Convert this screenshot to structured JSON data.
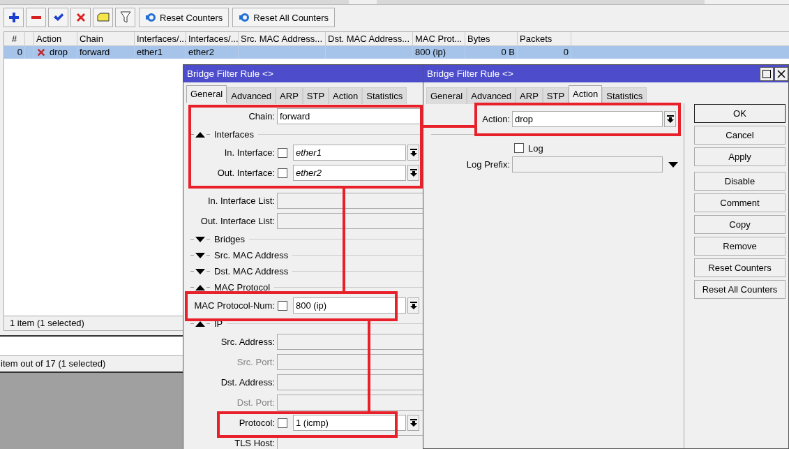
{
  "toolbar": {
    "buttons": [
      "Reset Counters",
      "Reset All Counters"
    ]
  },
  "table": {
    "columns": [
      "#",
      "Action",
      "Chain",
      "Interfaces/...",
      "Interfaces/...",
      "Src. MAC Address...",
      "Dst. MAC Address...",
      "MAC Prot...",
      "Bytes",
      "Packets"
    ],
    "rows": [
      {
        "selected": true,
        "number": "0",
        "action": "drop",
        "chain": "forward",
        "in_interface": "ether1",
        "out_interface": "ether2",
        "mac_protocol": "800 (ip)",
        "bytes": "0 B",
        "packets": "0"
      }
    ]
  },
  "status_bar": "1 item (1 selected)",
  "second_status_bar": "item out of 17 (1 selected)",
  "general_dialog": {
    "title": "Bridge Filter Rule <>",
    "tabs": [
      {
        "label": "General",
        "selected": true
      },
      {
        "label": "Advanced",
        "selected": false
      },
      {
        "label": "ARP",
        "selected": false
      },
      {
        "label": "STP",
        "selected": false
      },
      {
        "label": "Action",
        "selected": false
      },
      {
        "label": "Statistics",
        "selected": false
      }
    ],
    "fields": [
      {
        "kind": "text",
        "label": "Chain:",
        "value": "forward"
      },
      {
        "kind": "section",
        "label": "Interfaces",
        "expanded": true
      },
      {
        "kind": "check",
        "label": "In. Interface:",
        "checked": false,
        "value": "ether1",
        "italic": true
      },
      {
        "kind": "check",
        "label": "Out. Interface:",
        "checked": false,
        "value": "ether2",
        "italic": true
      },
      {
        "kind": "empty",
        "label": "In. Interface List:",
        "disabled": false
      },
      {
        "kind": "empty",
        "label": "Out. Interface List:",
        "disabled": false
      },
      {
        "kind": "section",
        "label": "Bridges",
        "expanded": false
      },
      {
        "kind": "section",
        "label": "Src. MAC Address",
        "expanded": false
      },
      {
        "kind": "section",
        "label": "Dst. MAC Address",
        "expanded": false
      },
      {
        "kind": "section",
        "label": "MAC Protocol",
        "expanded": true
      },
      {
        "kind": "check",
        "label": "MAC Protocol-Num:",
        "checked": false,
        "value": "800 (ip)",
        "italic": false
      },
      {
        "kind": "section",
        "label": "IP",
        "expanded": true
      },
      {
        "kind": "empty",
        "label": "Src. Address:",
        "disabled": false
      },
      {
        "kind": "empty",
        "label": "Src. Port:",
        "disabled": true
      },
      {
        "kind": "empty",
        "label": "Dst. Address:",
        "disabled": false
      },
      {
        "kind": "empty",
        "label": "Dst. Port:",
        "disabled": true
      },
      {
        "kind": "check",
        "label": "Protocol:",
        "checked": false,
        "value": "1 (icmp)",
        "italic": false
      },
      {
        "kind": "empty",
        "label": "TLS Host:",
        "disabled": false
      }
    ]
  },
  "action_dialog": {
    "title": "Bridge Filter Rule <>",
    "tabs": [
      {
        "label": "General",
        "selected": false
      },
      {
        "label": "Advanced",
        "selected": false
      },
      {
        "label": "ARP",
        "selected": false
      },
      {
        "label": "STP",
        "selected": false
      },
      {
        "label": "Action",
        "selected": true
      },
      {
        "label": "Statistics",
        "selected": false
      }
    ],
    "action_label": "Action:",
    "action_value": "drop",
    "log": {
      "label": "Log",
      "checked": false
    },
    "log_prefix_label": "Log Prefix:",
    "buttons": [
      {
        "label": "OK",
        "default": true
      },
      {
        "label": "Cancel",
        "default": false
      },
      {
        "label": "Apply",
        "default": false
      },
      {
        "label": "Disable",
        "default": false
      },
      {
        "label": "Comment",
        "default": false
      },
      {
        "label": "Copy",
        "default": false
      },
      {
        "label": "Remove",
        "default": false
      },
      {
        "label": "Reset Counters",
        "default": false
      },
      {
        "label": "Reset All Counters",
        "default": false
      }
    ]
  }
}
